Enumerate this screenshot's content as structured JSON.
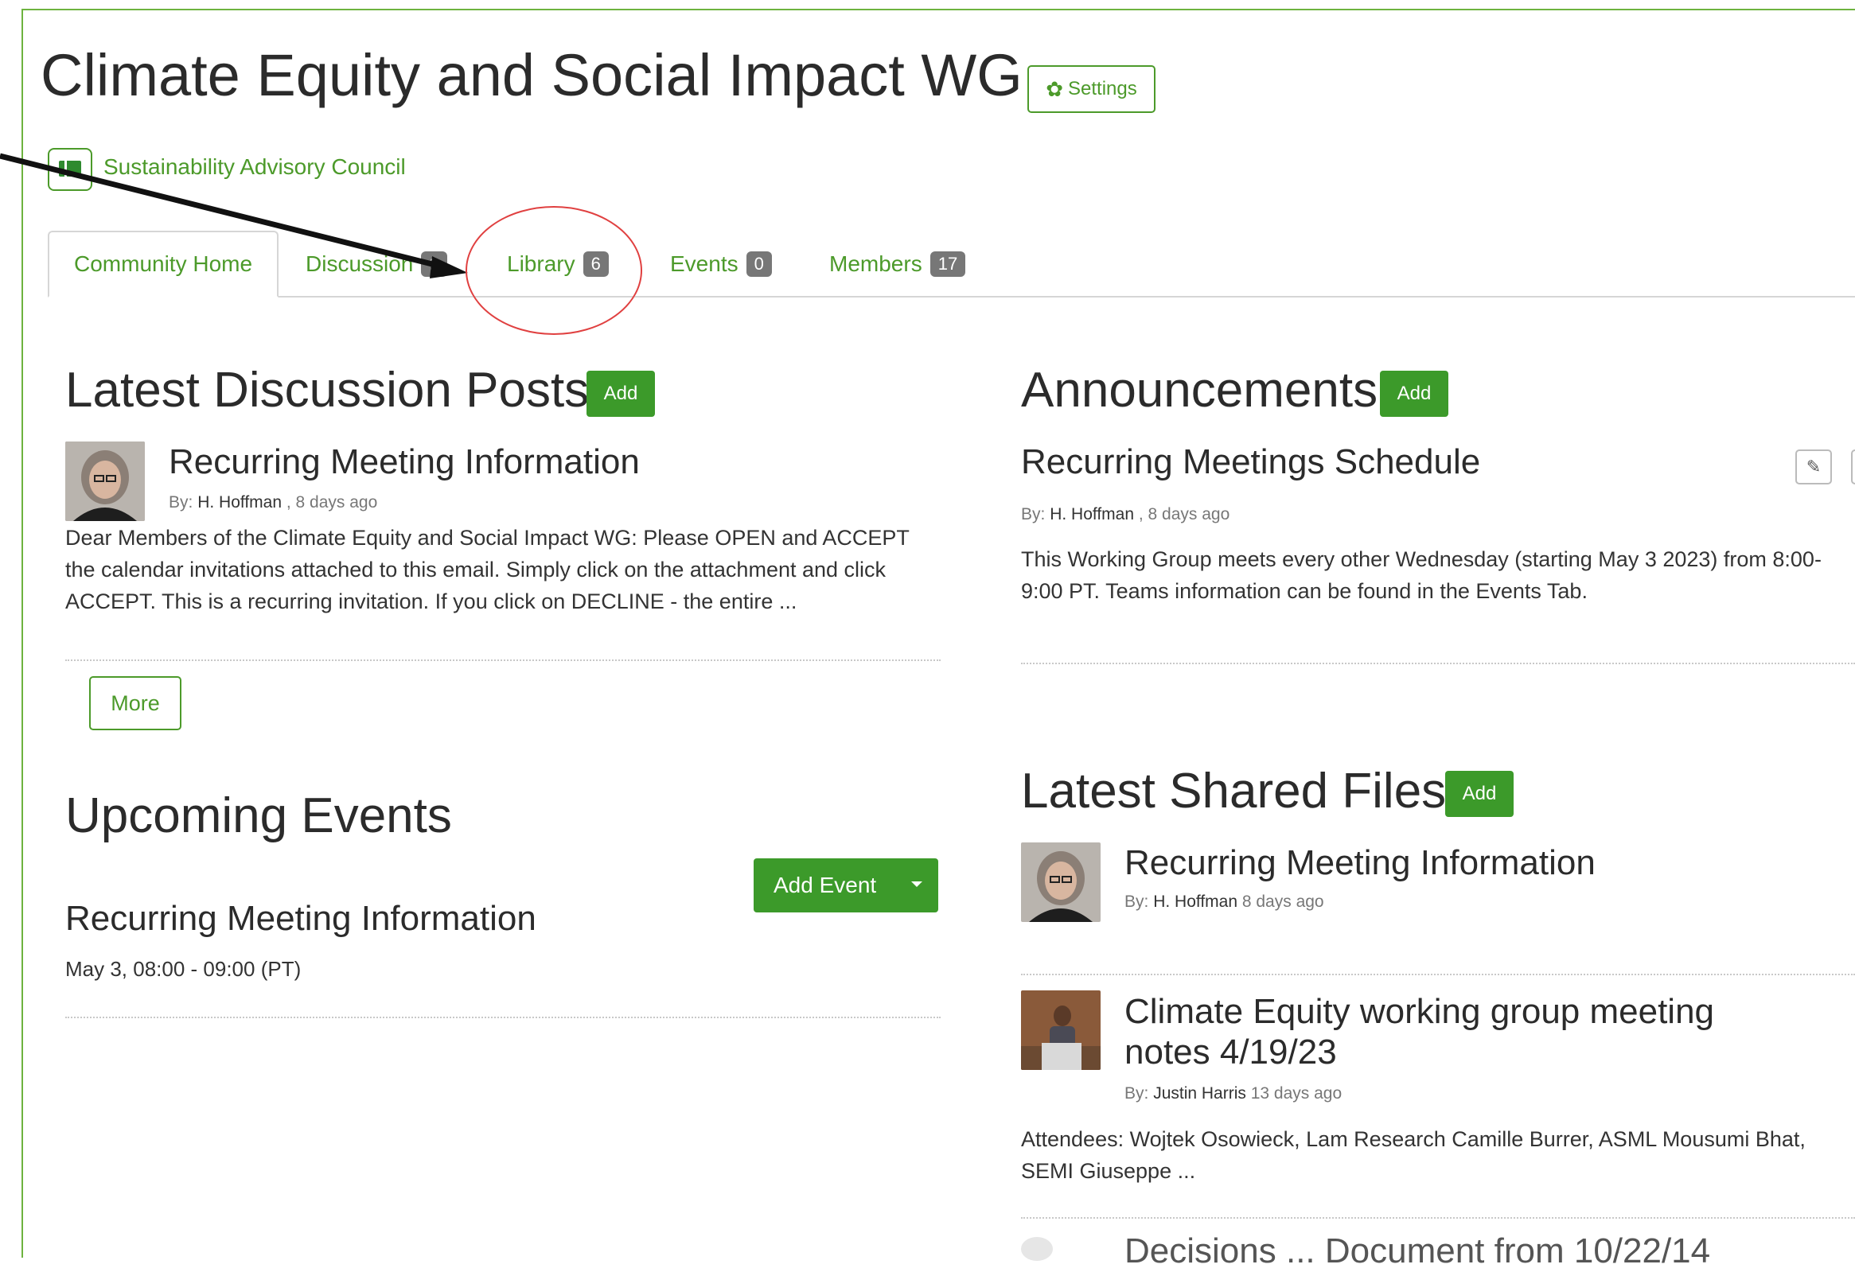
{
  "page": {
    "title": "Climate Equity and Social Impact WG",
    "settings_label": "Settings",
    "parent_community": "Sustainability Advisory Council"
  },
  "tabs": [
    {
      "label": "Community Home",
      "count": null
    },
    {
      "label": "Discussion",
      "count": "1"
    },
    {
      "label": "Library",
      "count": "6"
    },
    {
      "label": "Events",
      "count": "0"
    },
    {
      "label": "Members",
      "count": "17"
    }
  ],
  "discussion": {
    "heading": "Latest Discussion Posts",
    "add_label": "Add",
    "post": {
      "title": "Recurring Meeting Information",
      "by_label": "By:",
      "author": "H. Hoffman",
      "time": ", 8 days ago",
      "body": "Dear Members of the Climate Equity and Social Impact WG: Please OPEN and ACCEPT the calendar invitations attached to this email. Simply click on the attachment and click ACCEPT. This is a recurring invitation. If you click on DECLINE - the entire ..."
    },
    "more_label": "More"
  },
  "events": {
    "heading": "Upcoming Events",
    "add_event_label": "Add Event",
    "event": {
      "title": "Recurring Meeting Information",
      "time": "May 3, 08:00 - 09:00 (PT)"
    }
  },
  "announcements": {
    "heading": "Announcements",
    "add_label": "Add",
    "item": {
      "title": "Recurring Meetings Schedule",
      "by_label": "By:",
      "author": "H. Hoffman",
      "time": ", 8 days ago",
      "body": "This Working Group meets every other Wednesday (starting May 3 2023) from 8:00-9:00 PT.  Teams information can be found in the Events Tab."
    }
  },
  "files": {
    "heading": "Latest Shared Files",
    "add_label": "Add",
    "items": [
      {
        "title": "Recurring Meeting Information",
        "by_label": "By:",
        "author": "H. Hoffman",
        "time": "8 days ago"
      },
      {
        "title_line1": "Climate Equity working group meeting",
        "title_line2": "notes 4/19/23",
        "by_label": "By:",
        "author": "Justin Harris",
        "time": "13 days ago",
        "body": "Attendees: Wojtek Osowieck, Lam Research Camille Burrer, ASML Mousumi Bhat, SEMI Giuseppe ..."
      }
    ],
    "partial_next": "Decisions ... Document from 10/22/14"
  },
  "colors": {
    "accent": "#4c9a2a",
    "button_green": "#3c9a2a",
    "badge": "#777777",
    "annotation_circle": "#e04040"
  },
  "icons": [
    "gear-icon",
    "community-icon",
    "pencil-icon",
    "caret-down-icon"
  ]
}
